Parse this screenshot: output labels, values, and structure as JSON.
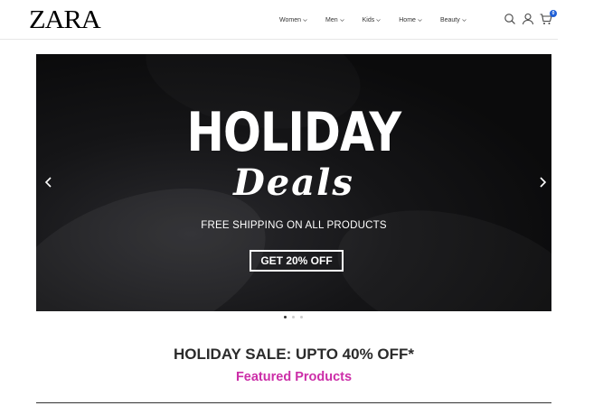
{
  "header": {
    "logo": "ZARA",
    "nav": [
      {
        "label": "Women"
      },
      {
        "label": "Men"
      },
      {
        "label": "Kids"
      },
      {
        "label": "Home"
      },
      {
        "label": "Beauty"
      }
    ],
    "cart_count": "0"
  },
  "hero": {
    "title": "HOLIDAY",
    "script": "Deals",
    "subtitle": "FREE SHIPPING ON ALL PRODUCTS",
    "cta": "GET 20% OFF",
    "slide_count": 3,
    "active_slide": 1
  },
  "section": {
    "sale_title": "HOLIDAY SALE: UPTO 40% OFF*",
    "featured": "Featured Products"
  },
  "colors": {
    "accent_pink": "#cc2ea8",
    "badge_blue": "#1f5fd6",
    "hero_bg": "#111113"
  },
  "icons": [
    "search-icon",
    "user-icon",
    "cart-icon",
    "chevron-down-icon",
    "chevron-left-icon",
    "chevron-right-icon"
  ]
}
